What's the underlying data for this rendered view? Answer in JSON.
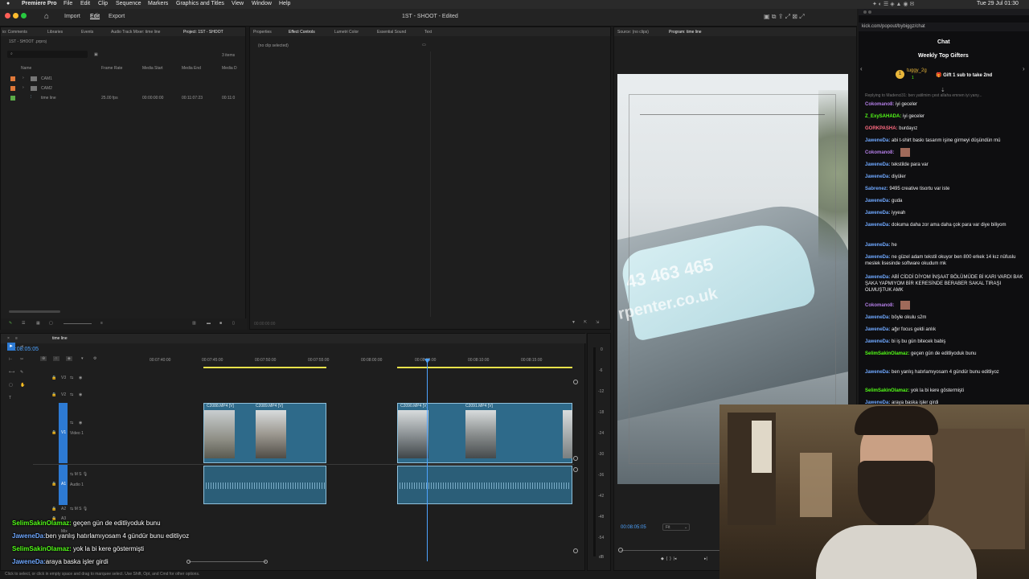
{
  "menubar": {
    "app": "Premiere Pro",
    "items": [
      "File",
      "Edit",
      "Clip",
      "Sequence",
      "Markers",
      "Graphics and Titles",
      "View",
      "Window",
      "Help"
    ],
    "datetime": "Tue 29 Jul 01:30"
  },
  "toolbar": {
    "home": "⌂",
    "import": "Import",
    "edit": "Edit",
    "export": "Export",
    "title": "1ST - SHOOT",
    "status": "- Edited"
  },
  "project_panel": {
    "tabs": [
      "io: Comments",
      "Libraries",
      "Events",
      "Audio Track Mixer: time line",
      "Project: 1ST - SHOOT"
    ],
    "project_file": "1ST - SHOOT .prproj",
    "items_count": "3 items",
    "columns": [
      "Name",
      "Frame Rate",
      "Media Start",
      "Media End",
      "Media D"
    ],
    "rows": [
      {
        "name": "CAM1",
        "frame_rate": "",
        "start": "",
        "end": "",
        "dur": ""
      },
      {
        "name": "CAM2",
        "frame_rate": "",
        "start": "",
        "end": "",
        "dur": ""
      },
      {
        "name": "time line",
        "frame_rate": "25.00 fps",
        "start": "00:00:00:00",
        "end": "00:11:07:23",
        "dur": "00:11:0"
      }
    ]
  },
  "effects_panel": {
    "tabs": [
      "Properties",
      "Effect Controls",
      "Lumetri Color",
      "Essential Sound",
      "Text"
    ],
    "placeholder": "(no clip selected)",
    "time": "00:00:00:00"
  },
  "program_monitor": {
    "source_tab": "Source: (no clips)",
    "program_tab": "Program: time line",
    "timecode": "00:08:05:05",
    "fit": "Fit",
    "car_text_line1": "43 463 465",
    "car_text_line2": "rpenter.co.uk"
  },
  "timeline": {
    "tab": "time line",
    "timecode": "00:08:05:05",
    "ruler": [
      "00:07:40:00",
      "00:07:45:00",
      "00:07:50:00",
      "00:07:55:00",
      "00:08:00:00",
      "00:08:05:00",
      "00:08:10:00",
      "00:08:15:00"
    ],
    "tracks": {
      "v3": "V3",
      "v2": "V2",
      "v1": "V1",
      "v1_name": "Video 1",
      "a1": "A1",
      "a1_name": "Audio 1",
      "a2": "A2",
      "a3": "A3",
      "mix": "Mix"
    },
    "clips": [
      "C2088.MP4 [V]",
      "C2089.MP4 [V]",
      "C2090.MP4 [V]",
      "C2091.MP4 [V]"
    ],
    "meter_scale": [
      "0",
      "-6",
      "-12",
      "-18",
      "-24",
      "-30",
      "-36",
      "-42",
      "-48",
      "-54",
      "dB"
    ]
  },
  "statusbar": "Click to select, or click in empty space and drag to marquee select. Use Shift, Opt, and Cmd for other options.",
  "chat": {
    "url": "kick.com/popout/bybiggz/chat",
    "title": "Chat",
    "gifters_title": "Weekly Top Gifters",
    "top_gifter": "tuggy_2g",
    "top_gifter_count": "1",
    "gift_cta": "Gift 1 sub to take 2nd",
    "reply_note": "Replying to Madenci31: ben yatilmim çest allaha emnen iyi yany...",
    "messages": [
      {
        "user": "Cokomano8:",
        "text": "iyi geceler",
        "color": "#b47fe8"
      },
      {
        "user": "Z_ExySAHADA:",
        "text": "iyi geceler",
        "color": "#53fc18"
      },
      {
        "user": "GORKPASHA:",
        "text": "burdayız",
        "color": "#ff6b81"
      },
      {
        "user": "JaweneDa:",
        "text": "abi t-shirt baskı tasarım işine girmeyi düşündün mü",
        "color": "#6fa8ff"
      },
      {
        "user": "Cokomano8:",
        "text": "",
        "color": "#b47fe8"
      },
      {
        "user": "JaweneDa:",
        "text": "tekstilde para var",
        "color": "#6fa8ff"
      },
      {
        "user": "JaweneDa:",
        "text": "diyüler",
        "color": "#6fa8ff"
      },
      {
        "user": "Sabrenez:",
        "text": "9495 creative tisortu var iste",
        "color": "#6fa8ff"
      },
      {
        "user": "JaweneDa:",
        "text": "guda",
        "color": "#6fa8ff"
      },
      {
        "user": "JaweneDa:",
        "text": "iyyeah",
        "color": "#6fa8ff"
      },
      {
        "user": "JaweneDa:",
        "text": "dokuma daha zor ama daha çok para var diye biliyom",
        "color": "#6fa8ff"
      },
      {
        "user": "JaweneDa:",
        "text": "he",
        "color": "#6fa8ff"
      },
      {
        "user": "JaweneDa:",
        "text": "ne güzel adam tekstil okuyor ben 800 erkek 14 kız nüfuslu meslek lisesinde software okudum mk",
        "color": "#6fa8ff"
      },
      {
        "user": "JaweneDa:",
        "text": "ABİ CİDDİ DİYOM İNŞAAT BÖLÜMÜDE Bİ KARI VARDI BAK ŞAKA YAPMIYOM BİR KERESİNDE BERABER SAKAL TIRAŞI OLMUŞTUK AMK",
        "color": "#6fa8ff"
      },
      {
        "user": "Cokomano8:",
        "text": "",
        "color": "#b47fe8"
      },
      {
        "user": "JaweneDa:",
        "text": "böyle okulu s2m",
        "color": "#6fa8ff"
      },
      {
        "user": "JaweneDa:",
        "text": "ağır focus geldi anlık",
        "color": "#6fa8ff"
      },
      {
        "user": "JaweneDa:",
        "text": "bi iş bu gün bitecek babiş",
        "color": "#6fa8ff"
      },
      {
        "user": "SelimSakinOlamaz:",
        "text": "geçen gün de editliyoduk bunu",
        "color": "#53fc18"
      },
      {
        "user": "JaweneDa:",
        "text": "ben yanlış hatırlamıyosam 4 gündür bunu editliyoz",
        "color": "#6fa8ff"
      },
      {
        "user": "SelimSakinOlamaz:",
        "text": "yok la bi kere göstermişti",
        "color": "#53fc18"
      },
      {
        "user": "JaweneDa:",
        "text": "araya baska işler girdi",
        "color": "#6fa8ff"
      }
    ]
  },
  "overlay_chat": [
    {
      "user": "SelimSakinOlamaz:",
      "text": "geçen gün de editliyoduk bunu",
      "color": "#53fc18"
    },
    {
      "user": "JaweneDa:",
      "text": "ben yanlış hatırlamıyosam 4 gündür bunu editliyoz",
      "color": "#6fa8ff"
    },
    {
      "user": "SelimSakinOlamaz:",
      "text": "yok la bi kere göstermişti",
      "color": "#53fc18"
    },
    {
      "user": "JaweneDa:",
      "text": "araya baska işler girdi",
      "color": "#6fa8ff"
    }
  ]
}
